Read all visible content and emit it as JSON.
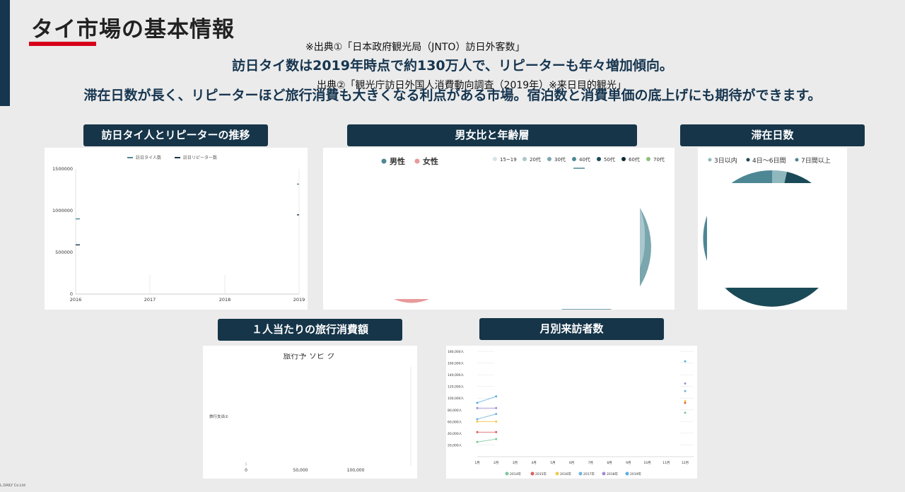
{
  "header": {
    "title": "タイ市場の基本情報",
    "source_1": "※出典①「日本政府観光局（JNTO）訪日外客数」",
    "source_2": "出典②「観光庁訪日外国人消費動向調査（2019年）※来日目的観光」"
  },
  "lead": {
    "line1": "訪日タイ数は2019年時点で約130万人で、リピーターも年々増加傾向。",
    "line2": "滞在日数が長く、リピーターほど旅行消費も大きくなる利点がある市場。宿泊数と消費単価の底上げにも期待ができます。"
  },
  "panels": {
    "visitors": {
      "label": "訪日タイ人とリピーターの推移",
      "legend": [
        "訪日タイ人数",
        "訪日リピーター数"
      ],
      "y_ticks": [
        "1500000",
        "1000000",
        "500000",
        "0"
      ],
      "x_ticks": [
        "2016",
        "2017",
        "2018",
        "2019"
      ]
    },
    "gender_age": {
      "label": "男女比と年齢層",
      "gender_legend": [
        "男性",
        "女性"
      ],
      "age_legend": [
        "15~19",
        "20代",
        "30代",
        "40代",
        "50代",
        "60代",
        "70代"
      ]
    },
    "stay": {
      "label": "滞在日数",
      "legend": [
        "3日以内",
        "4日～6日間",
        "7日間以上"
      ]
    },
    "spend": {
      "label": "１人当たりの旅行消費額",
      "chart_title": "旅行予 ソピ ク",
      "category": "旅行支出①",
      "x_ticks": [
        "0",
        "50,000",
        "100,000"
      ]
    },
    "monthly": {
      "label": "月別来訪者数",
      "y_ticks": [
        "180,000人",
        "160,000人",
        "140,000人",
        "120,000人",
        "100,000人",
        "80,000人",
        "60,000人",
        "40,000人",
        "20,000人"
      ],
      "x_ticks": [
        "1月",
        "2月",
        "3月",
        "4月",
        "5月",
        "6月",
        "7月",
        "8月",
        "9月",
        "10月",
        "11月",
        "12月"
      ],
      "legend": [
        "2014年",
        "2015年",
        "2016年",
        "2017年",
        "2018年",
        "2019年"
      ]
    }
  },
  "footer": {
    "logo": "L.DAILY Co.Ltd"
  },
  "colors": {
    "navy": "#163549",
    "accent_red": "#d7001a",
    "teal_dark": "#1a4a57",
    "teal_mid": "#4e8794",
    "teal_light": "#8fb8be",
    "pink": "#e89a9a"
  },
  "chart_data": [
    {
      "type": "line",
      "title": "",
      "x": [
        "2016",
        "2017",
        "2018",
        "2019"
      ],
      "ylim": [
        0,
        1500000
      ],
      "series": [
        {
          "name": "訪日タイ人数",
          "values": [
            901500,
            null,
            null,
            1318000
          ]
        },
        {
          "name": "訪日リピーター数",
          "values": [
            590000,
            null,
            null,
            950000
          ]
        }
      ]
    },
    {
      "type": "line",
      "title": "",
      "x": [
        "1月",
        "2月",
        "3月",
        "4月",
        "5月",
        "6月",
        "7月",
        "8月",
        "9月",
        "10月",
        "11月",
        "12月"
      ],
      "ylim": [
        0,
        180000
      ],
      "series": [
        {
          "name": "2014年",
          "values": [
            25000,
            30000,
            null,
            null,
            null,
            null,
            null,
            null,
            null,
            null,
            null,
            75000
          ]
        },
        {
          "name": "2015年",
          "values": [
            42000,
            42000,
            null,
            null,
            null,
            null,
            null,
            null,
            null,
            null,
            null,
            92000
          ]
        },
        {
          "name": "2016年",
          "values": [
            60000,
            60000,
            null,
            null,
            null,
            null,
            null,
            null,
            null,
            null,
            null,
            95000
          ]
        },
        {
          "name": "2017年",
          "values": [
            64000,
            73000,
            null,
            null,
            null,
            null,
            null,
            null,
            null,
            null,
            null,
            112000
          ]
        },
        {
          "name": "2018年",
          "values": [
            83000,
            83000,
            null,
            null,
            null,
            null,
            null,
            null,
            null,
            null,
            null,
            125000
          ]
        },
        {
          "name": "2019年",
          "values": [
            92000,
            103000,
            null,
            null,
            null,
            null,
            null,
            null,
            null,
            null,
            null,
            163000
          ]
        }
      ]
    }
  ]
}
